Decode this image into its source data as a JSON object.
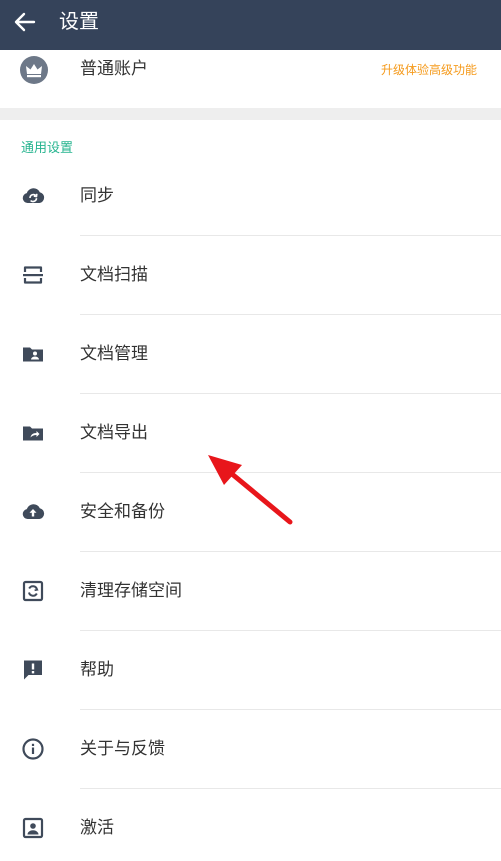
{
  "header": {
    "title": "设置",
    "back_icon": "arrow-left-icon"
  },
  "account": {
    "icon": "crown-icon",
    "label": "普通账户",
    "upgrade_link": "升级体验高级功能"
  },
  "section": {
    "title": "通用设置"
  },
  "menu": {
    "items": [
      {
        "label": "同步",
        "icon": "sync-cloud-icon"
      },
      {
        "label": "文档扫描",
        "icon": "scan-frame-icon"
      },
      {
        "label": "文档管理",
        "icon": "folder-person-icon"
      },
      {
        "label": "文档导出",
        "icon": "folder-export-icon"
      },
      {
        "label": "安全和备份",
        "icon": "cloud-upload-icon"
      },
      {
        "label": "清理存储空间",
        "icon": "clean-storage-icon"
      },
      {
        "label": "帮助",
        "icon": "feedback-alert-icon"
      },
      {
        "label": "关于与反馈",
        "icon": "info-icon"
      },
      {
        "label": "激活",
        "icon": "account-box-icon"
      }
    ]
  },
  "colors": {
    "appbar": "#35435a",
    "accent_green": "#26b48f",
    "accent_orange": "#f59a1b",
    "icon_gray": "#3f4a5a",
    "annotation_arrow": "#e8161b"
  }
}
